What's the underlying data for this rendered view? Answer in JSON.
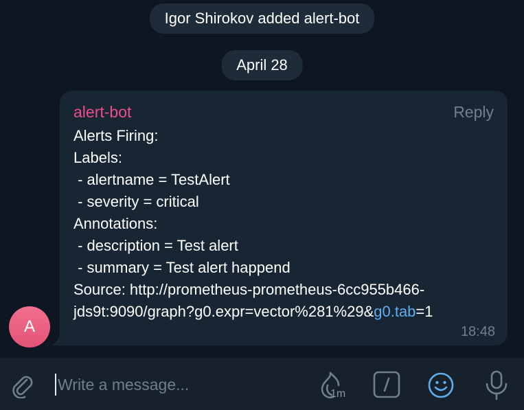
{
  "chat": {
    "service_added": "Igor Shirokov added alert-bot",
    "date_divider": "April 28"
  },
  "message": {
    "sender": "alert-bot",
    "reply_label": "Reply",
    "lines": [
      "Alerts Firing:",
      "Labels:",
      " - alertname = TestAlert",
      " - severity = critical",
      "Annotations:",
      " - description = Test alert",
      " - summary = Test alert happend",
      "Source: http://prometheus-prometheus-6cc955b466-"
    ],
    "last_line_prefix": "jds9t:9090/graph?g0.expr=vector%281%29&",
    "last_line_link": "g0.tab",
    "last_line_suffix": "=1",
    "time": "18:48",
    "avatar_letter": "A"
  },
  "composer": {
    "placeholder": "Write a message...",
    "timer_label": "1m",
    "icons": [
      "attach-icon",
      "timer-icon",
      "bot-command-icon",
      "emoji-icon",
      "microphone-icon"
    ]
  },
  "colors": {
    "background": "#0e1621",
    "bubble": "#182533",
    "sender": "#ee4c8a",
    "link": "#5eaef0",
    "muted": "#6f7f8e",
    "accent": "#5eaef0"
  }
}
